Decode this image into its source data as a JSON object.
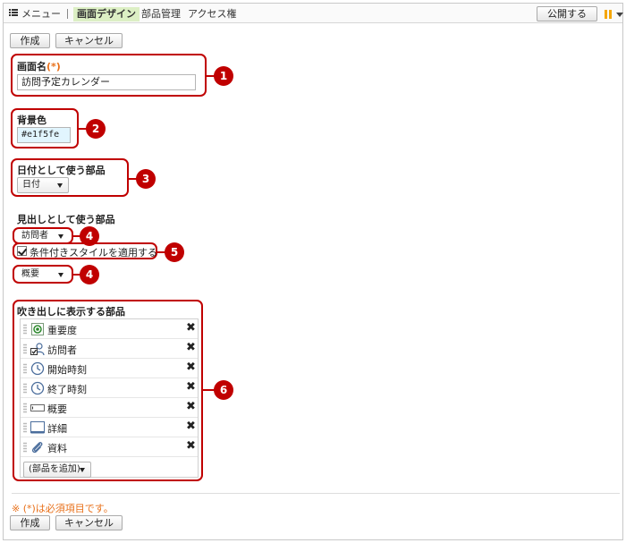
{
  "topbar": {
    "menu_label": "メニュー",
    "tabs": [
      "画面デザイン",
      "部品管理",
      "アクセス権"
    ],
    "publish_label": "公開する"
  },
  "actions": {
    "create_label": "作成",
    "cancel_label": "キャンセル"
  },
  "screen_name": {
    "label": "画面名",
    "required_mark": "(*)",
    "value": "訪問予定カレンダー"
  },
  "background": {
    "label": "背景色",
    "value": "#e1f5fe"
  },
  "date_part": {
    "label": "日付として使う部品",
    "selected": "日付"
  },
  "heading_part": {
    "label": "見出しとして使う部品",
    "selected_1": "訪問者",
    "conditional_style_label": "条件付きスタイルを適用する",
    "conditional_style_checked": true,
    "selected_2": "概要"
  },
  "balloon_parts": {
    "label": "吹き出しに表示する部品",
    "items": [
      {
        "label": "重要度",
        "icon": "radio-icon"
      },
      {
        "label": "訪問者",
        "icon": "user-check-icon"
      },
      {
        "label": "開始時刻",
        "icon": "clock-icon"
      },
      {
        "label": "終了時刻",
        "icon": "clock-icon"
      },
      {
        "label": "概要",
        "icon": "textbox-icon"
      },
      {
        "label": "詳細",
        "icon": "textarea-icon"
      },
      {
        "label": "資料",
        "icon": "paperclip-icon"
      }
    ],
    "delete_glyph": "✖",
    "add_select": "(部品を追加)"
  },
  "callouts": [
    "1",
    "2",
    "3",
    "4",
    "5",
    "4",
    "6"
  ],
  "footer": {
    "note": "※ (*)は必須項目です。"
  },
  "colors": {
    "callout": "#c00000",
    "required": "#e8701a",
    "active_tab": "#dcefc4",
    "input_bg": "#e1f5fe"
  }
}
